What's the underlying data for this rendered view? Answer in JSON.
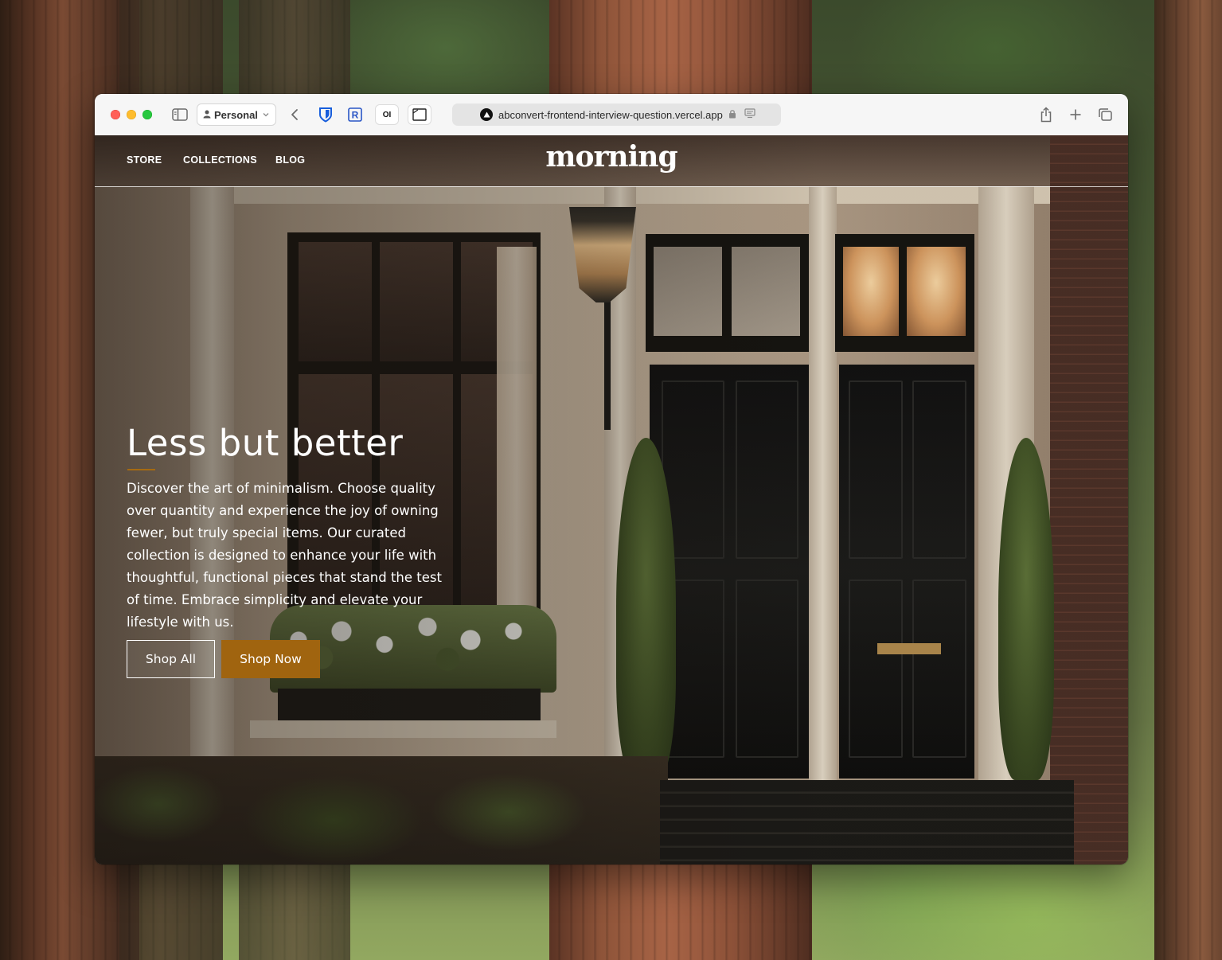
{
  "browser": {
    "profile_label": "Personal",
    "url": "abconvert-frontend-interview-question.vercel.app",
    "extensions": [
      {
        "name": "bitwarden-icon"
      },
      {
        "name": "rakuten-icon",
        "label": "R"
      },
      {
        "name": "oi-icon",
        "label": "OI"
      },
      {
        "name": "reader-extension-icon"
      }
    ]
  },
  "site": {
    "logo": "morning",
    "nav": {
      "store": "STORE",
      "collections": "COLLECTIONS",
      "blog": "BLOG"
    },
    "hero": {
      "title": "Less but better",
      "description": "Discover the art of minimalism. Choose quality over quantity and experience the joy of owning fewer, but truly special items. Our curated collection is designed to enhance your life with thoughtful, functional pieces that stand the test of time. Embrace simplicity and elevate your lifestyle with us.",
      "shop_all_label": "Shop All",
      "shop_now_label": "Shop Now",
      "accent_color": "#a0640f"
    }
  }
}
